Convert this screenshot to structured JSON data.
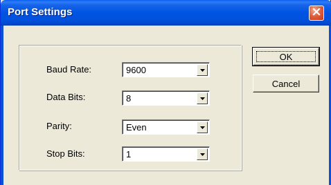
{
  "window": {
    "title": "Port Settings"
  },
  "fields": [
    {
      "label": "Baud Rate:",
      "value": "9600"
    },
    {
      "label": "Data Bits:",
      "value": "8"
    },
    {
      "label": "Parity:",
      "value": "Even"
    },
    {
      "label": "Stop Bits:",
      "value": "1"
    }
  ],
  "buttons": {
    "ok": "OK",
    "cancel": "Cancel"
  },
  "icons": {
    "close": "close-icon",
    "dropdown": "chevron-down-icon"
  },
  "colors": {
    "titlebar": "#0054e3",
    "dialog_bg": "#ece9d8",
    "close_button": "#e0613e"
  }
}
